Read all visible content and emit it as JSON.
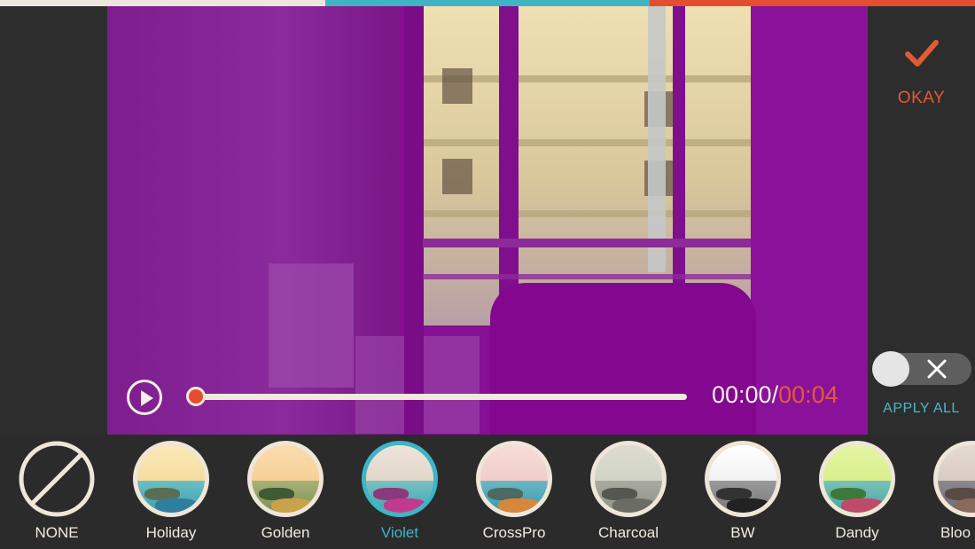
{
  "colors": {
    "strip": [
      "#ece6dc",
      "#3fb4c4",
      "#e24e2f"
    ],
    "accent_orange": "#e25a36",
    "accent_teal": "#3fb4c4",
    "video_tint": "#860f94"
  },
  "header": {
    "okay_label": "OKAY",
    "okay_icon": "checkmark-icon"
  },
  "player": {
    "play_icon": "play-icon",
    "progress": 0.0,
    "current_time": "00:00",
    "separator": "/",
    "duration": "00:04"
  },
  "apply_all": {
    "label": "APPLY ALL",
    "toggle_icon": "close-x-icon",
    "enabled": false
  },
  "filters": {
    "selected": "Violet",
    "items": [
      {
        "label": "NONE",
        "icon": "none-prohibited-icon",
        "sky": "#2b2b2b",
        "sea": "#2b2b2b"
      },
      {
        "label": "Holiday",
        "sky": "#f3dca0",
        "sea": "#3a9fb0"
      },
      {
        "label": "Golden",
        "sky": "#f6cf96",
        "sea": "#7e8f56"
      },
      {
        "label": "Violet",
        "sky": "#dfd6c9",
        "sea": "#3aa7b1"
      },
      {
        "label": "CrossPro",
        "sky": "#f1cdc8",
        "sea": "#2f9bb0"
      },
      {
        "label": "Charcoal",
        "sky": "#d2d3c7",
        "sea": "#8e9187"
      },
      {
        "label": "BW",
        "sky": "#f0f0f0",
        "sea": "#777777"
      },
      {
        "label": "Dandy",
        "sky": "#d7ee8a",
        "sea": "#4aa0a2"
      },
      {
        "label": "Bloo",
        "sky": "#d8ccc4",
        "sea": "#6d6a70"
      }
    ]
  }
}
